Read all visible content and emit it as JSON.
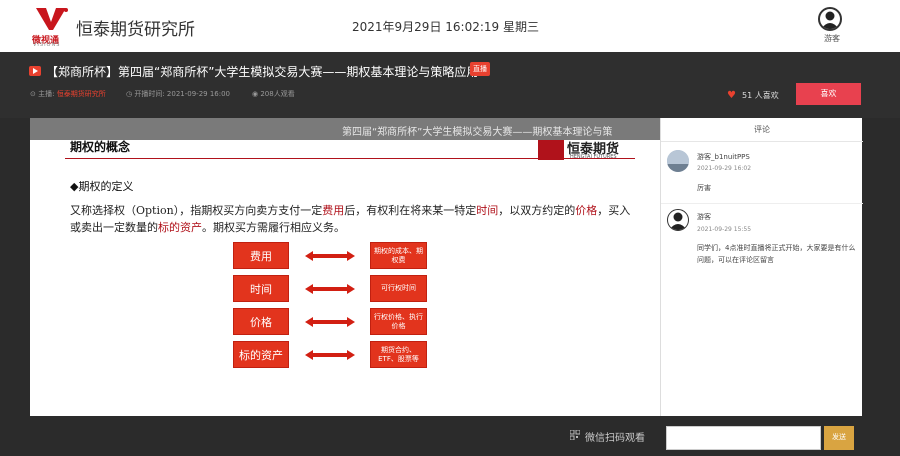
{
  "header": {
    "logo_text": "微视通",
    "logo_sub": "VISIONS",
    "org_name": "恒泰期货研究所",
    "clock": "2021年9月29日  16:02:19  星期三",
    "user_name": "游客"
  },
  "titlebar": {
    "title": "【郑商所杯】第四届“郑商所杯”大学生模拟交易大赛——期权基本理论与策略应用",
    "badge": "直播",
    "host_label": "主播:",
    "host_name": "恒泰期货研究所",
    "time_label": "开播时间: 2021-09-29 16:00",
    "viewers": "208人观看",
    "like_count": "51 人喜欢",
    "like_button": "喜欢"
  },
  "video": {
    "banner": "第四届“郑商所杯”大学生模拟交易大赛——期权基本理论与策",
    "slide_title": "期权的概念",
    "logo_name": "恒泰期货",
    "logo_en": "HENGTAI FUTURES",
    "def_head": "◆期权的定义",
    "def_parts": {
      "p1": "又称选择权（Option），指期权买方向卖方支付一定",
      "h1": "费用",
      "p2": "后，有权利在将来某一特定",
      "h2": "时间",
      "p3": "，以双方约定的",
      "h3": "价格",
      "p4": "，买入或卖出一定数量的",
      "h4": "标的资产",
      "p5": "。期权买方需履行相应义务。"
    },
    "rows": [
      {
        "left": "费用",
        "right": "期权的成本、期权费"
      },
      {
        "left": "时间",
        "right": "可行权时间"
      },
      {
        "left": "价格",
        "right": "行权价格、执行价格"
      },
      {
        "left": "标的资产",
        "right": "期货合约、ETF、股票等"
      }
    ],
    "qr_label": "微信扫码观看"
  },
  "comments": {
    "header": "评论",
    "items": [
      {
        "name": "游客_b1nuitPPS",
        "time": "2021-09-29 16:02",
        "body": "厉害"
      },
      {
        "name": "游客",
        "time": "2021-09-29 15:55",
        "body": "同学们，4点准时直播将正式开始，大家要是有什么问题，可以在评论区留言"
      }
    ],
    "input_placeholder": "",
    "send": "发送"
  },
  "colors": {
    "accent_red": "#e8414f",
    "slide_red": "#e2341d",
    "send_gold": "#d9a441"
  }
}
